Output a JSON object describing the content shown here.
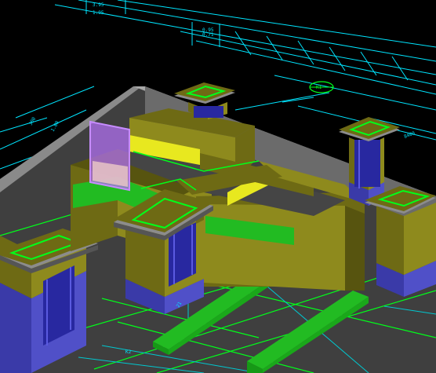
{
  "app": {
    "name": "3D CAD model viewport",
    "background_color": "#000000"
  },
  "palette": {
    "cad_line": "#00e5ff",
    "green_line": "#00ff1a",
    "olive_light": "#8e8a1d",
    "olive_mid": "#6e6a14",
    "olive_dark": "#57540f",
    "blue_base": "#5050c8",
    "blue_dark": "#3a3aa8",
    "green_beam": "#22bb22",
    "yellow_beam": "#e8e81f",
    "gray_wall": "#6b6b6b",
    "gray_top": "#b0b0b0",
    "selection_purple": "#b070f0"
  },
  "labels": {
    "tag_1": "3.95",
    "tag_2": "1.95",
    "tag_3": "0.95",
    "tag_4": "8400",
    "tag_5": "300",
    "tag_6": "1.80",
    "tag_7": "21",
    "tag_8": "0.71",
    "tag_9": "K1",
    "tag_10": "K2"
  }
}
